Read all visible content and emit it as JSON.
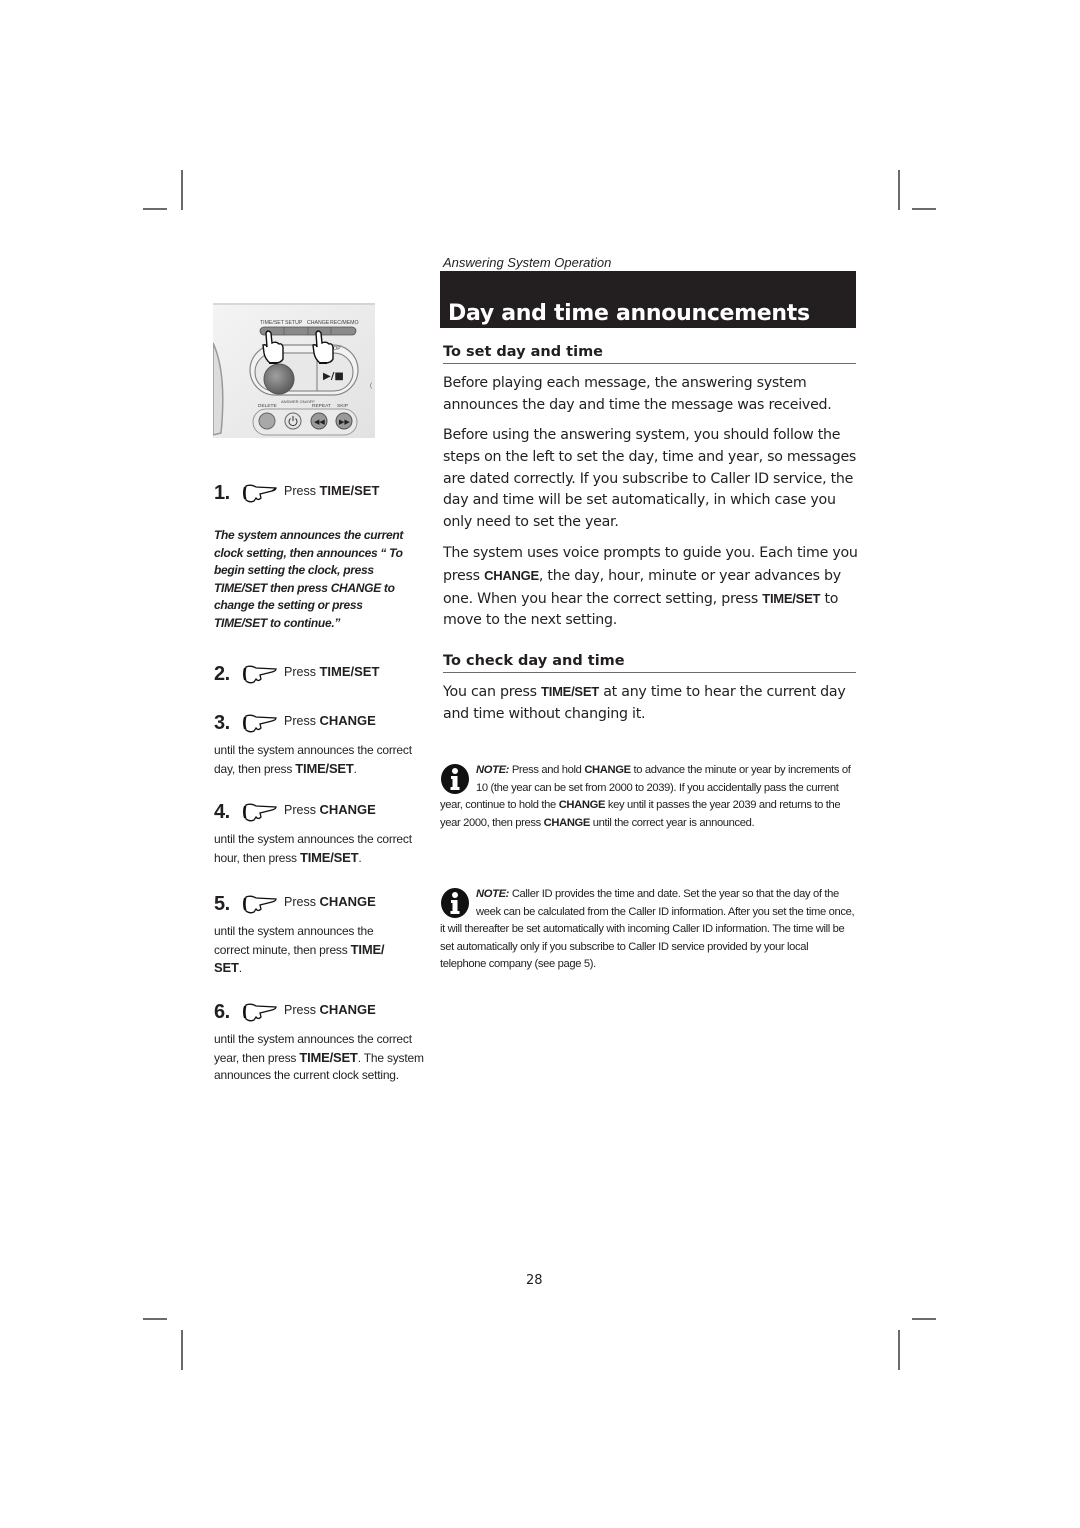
{
  "page": {
    "section_label": "Answering System Operation",
    "title": "Day and time announcements",
    "page_number": "28"
  },
  "device": {
    "buttons_top": [
      "TIME/SET",
      "SETUP",
      "CHANGE",
      "REC/MEMO"
    ],
    "stop_label": "STOP",
    "play_stop_label": "▶/■",
    "buttons_bottom": [
      "DELETE",
      "ANSWER ON/OFF",
      "REPEAT",
      "SKIP"
    ]
  },
  "steps": [
    {
      "num": "1.",
      "press": "Press",
      "key": "TIME/SET",
      "icon": "pointing-hand-icon"
    },
    {
      "num": "2.",
      "press": "Press",
      "key": "TIME/SET",
      "icon": "pointing-hand-icon"
    },
    {
      "num": "3.",
      "press": "Press",
      "key": "CHANGE",
      "icon": "pointing-hand-icon",
      "desc_pre": "until the system announces the correct day, then press ",
      "desc_key": "TIME/SET",
      "desc_post": "."
    },
    {
      "num": "4.",
      "press": "Press",
      "key": "CHANGE",
      "icon": "pointing-hand-icon",
      "desc_pre": "until the system announces the correct hour, then press ",
      "desc_key": "TIME/SET",
      "desc_post": "."
    },
    {
      "num": "5.",
      "press": "Press",
      "key": "CHANGE",
      "icon": "pointing-hand-icon",
      "desc_pre": "until the system announces the correct minute, then press ",
      "desc_key": "TIME/ SET",
      "desc_post": "."
    },
    {
      "num": "6.",
      "press": "Press",
      "key": "CHANGE",
      "icon": "pointing-hand-icon",
      "desc_pre": "until the system announces the correct year,  then press ",
      "desc_key": "TIME/SET",
      "desc_post": ". The system announces the current clock setting."
    }
  ],
  "step1_italic": "The system announces the current clock setting, then announces “ To begin setting the clock, press TIME/SET then press  CHANGE to change the setting or press TIME/SET to continue.”",
  "set_section": {
    "heading": "To set day and time",
    "p1": "Before playing each message, the answering system announces the day and time the message was received.",
    "p2": "Before using the answering system, you should follow the steps on the left to set the day, time and year, so messages are dated correctly. If you subscribe to Caller ID service, the day and time will be set automatically, in which case you only need to set the year.",
    "p3_a": "The system uses voice prompts to guide you. Each time you press ",
    "p3_key1": "CHANGE",
    "p3_b": ", the day, hour, minute or year advances by one. When you hear the correct setting, press ",
    "p3_key2": "TIME/SET",
    "p3_c": " to move to the next setting."
  },
  "check_section": {
    "heading": "To check day and time",
    "p_a": "You can press ",
    "p_key": "TIME/SET",
    "p_b": " at any time to hear the current day and time without changing it."
  },
  "notes": [
    {
      "label": "NOTE:",
      "a": " Press and hold ",
      "k1": "CHANGE",
      "b": " to advance the minute or year by increments of 10 (the year can be set from 2000 to 2039). If you accidentally pass the current year, continue to hold the ",
      "k2": "CHANGE",
      "c": " key until it passes the year 2039 and returns to the year 2000, then press ",
      "k3": "CHANGE",
      "d": " until the correct year is announced."
    },
    {
      "label": "NOTE:",
      "text": " Caller ID provides the time and date. Set the year so that the day of the week can be calculated from the Caller ID information. After you set the time once, it will thereafter be set automatically with incoming Caller ID information. The time will be set automatically only if you subscribe to Caller ID service provided by your local telephone company (see page 5)."
    }
  ]
}
